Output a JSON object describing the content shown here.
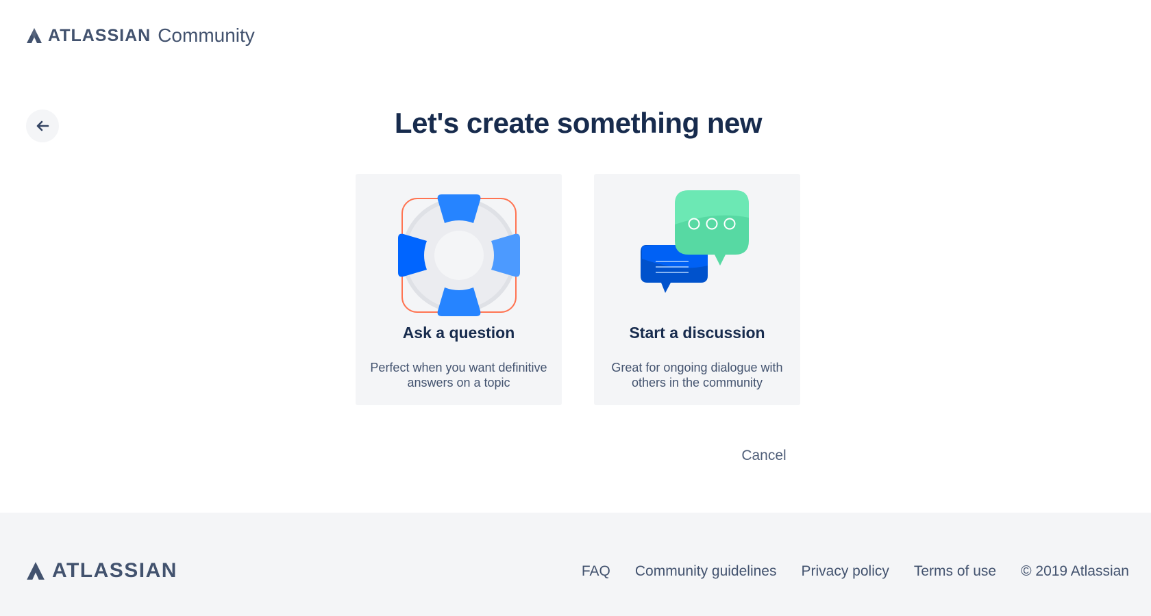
{
  "header": {
    "brand": "ATLASSIAN",
    "product": "Community"
  },
  "page": {
    "title": "Let's create something new"
  },
  "cards": [
    {
      "title": "Ask a question",
      "description": "Perfect when you want definitive answers on a topic",
      "icon": "lifebuoy-icon"
    },
    {
      "title": "Start a discussion",
      "description": "Great for ongoing dialogue with others in the community",
      "icon": "chat-bubbles-icon"
    }
  ],
  "actions": {
    "cancel_label": "Cancel"
  },
  "footer": {
    "brand": "ATLASSIAN",
    "links": [
      "FAQ",
      "Community guidelines",
      "Privacy policy",
      "Terms of use"
    ],
    "copyright": "© 2019 Atlassian"
  },
  "colors": {
    "primary_blue": "#2684ff",
    "green": "#57d9a3",
    "dark_text": "#172b4d",
    "muted_text": "#42526e",
    "card_bg": "#f4f5f7",
    "orange_outline": "#ff5630"
  }
}
